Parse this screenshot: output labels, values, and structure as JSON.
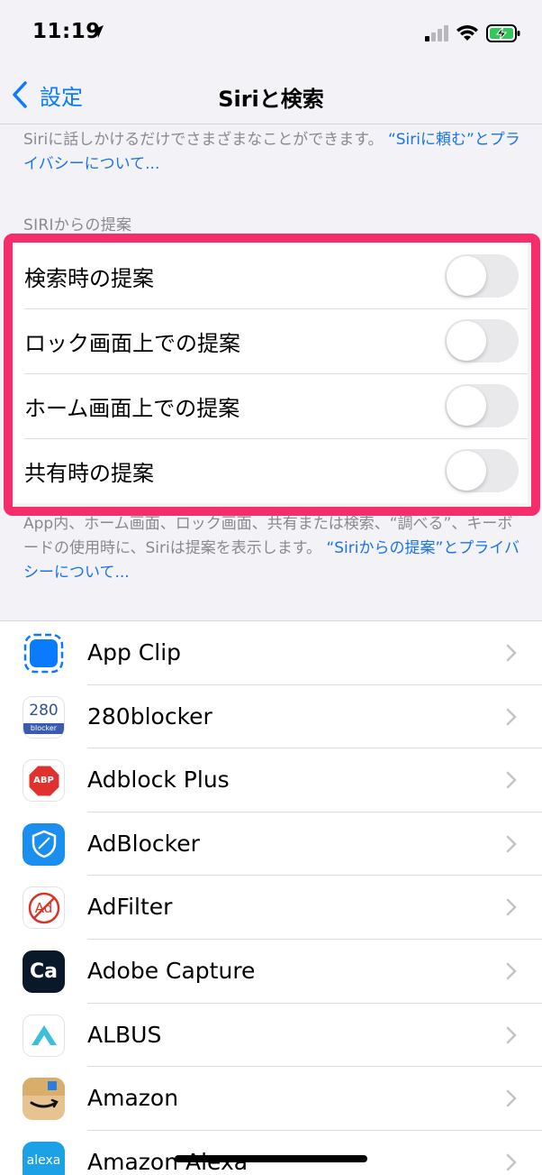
{
  "status_bar": {
    "time": "11:19",
    "icons": [
      "location-arrow-icon",
      "cellular-signal-icon",
      "wifi-icon",
      "battery-charging-icon"
    ]
  },
  "nav": {
    "back_label": "設定",
    "title": "Siriと検索"
  },
  "intro": {
    "text": "Siriに話しかけるだけでさまざまなことができます。",
    "link": "“Siriに頼む”とプライバシーについて..."
  },
  "suggestions": {
    "header": "SIRIからの提案",
    "rows": [
      {
        "label": "検索時の提案",
        "enabled": false
      },
      {
        "label": "ロック画面上での提案",
        "enabled": false
      },
      {
        "label": "ホーム画面上での提案",
        "enabled": false
      },
      {
        "label": "共有時の提案",
        "enabled": false
      }
    ],
    "footer_text": "App内、ホーム画面、ロック画面、共有または検索、“調べる”、キーボードの使用時に、Siriは提案を表示します。",
    "footer_link": "“Siriからの提案”とプライバシーについて..."
  },
  "apps": [
    {
      "name": "App Clip",
      "icon": "app-clip-icon"
    },
    {
      "name": "280blocker",
      "icon": "280blocker-icon",
      "icon_text": "280",
      "icon_subtext": "blocker"
    },
    {
      "name": "Adblock Plus",
      "icon": "adblock-plus-icon",
      "icon_text": "ABP"
    },
    {
      "name": "AdBlocker",
      "icon": "adblocker-shield-icon"
    },
    {
      "name": "AdFilter",
      "icon": "adfilter-icon",
      "icon_text": "Ad"
    },
    {
      "name": "Adobe Capture",
      "icon": "adobe-capture-icon",
      "icon_text": "Ca"
    },
    {
      "name": "ALBUS",
      "icon": "albus-icon"
    },
    {
      "name": "Amazon",
      "icon": "amazon-icon"
    },
    {
      "name": "Amazon Alexa",
      "icon": "amazon-alexa-icon",
      "icon_text": "alexa"
    }
  ],
  "colors": {
    "accent": "#0a7aff",
    "highlight": "#f52e6b",
    "background": "#f2f2f7"
  }
}
